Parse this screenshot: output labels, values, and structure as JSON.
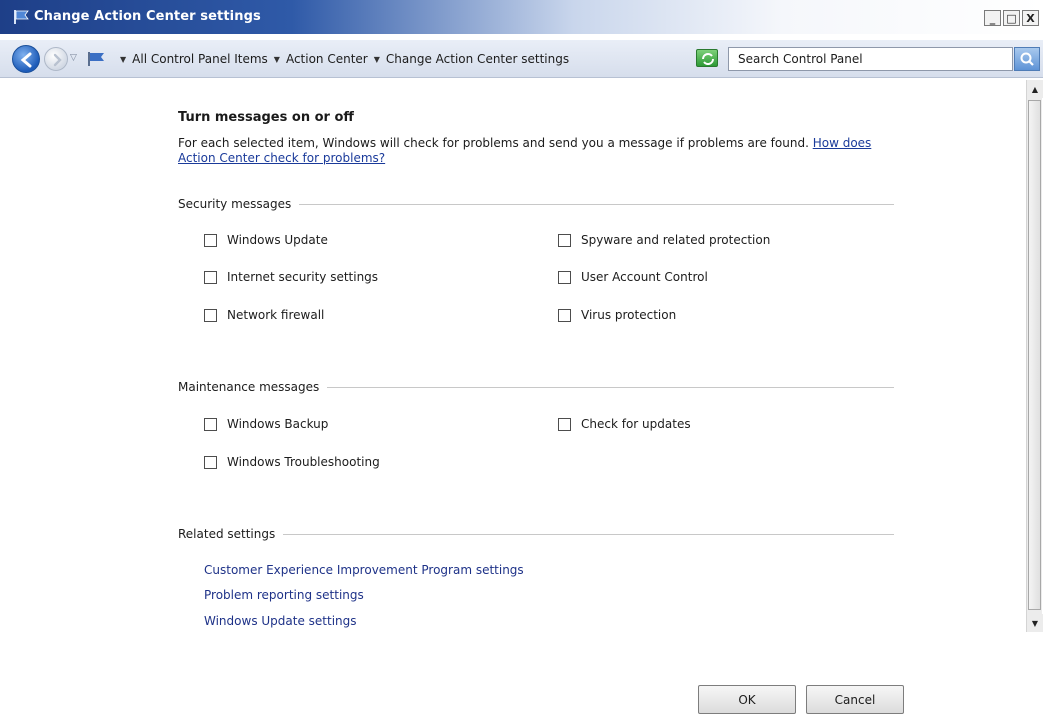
{
  "window": {
    "title": "Change Action Center settings",
    "minimize_label": "_",
    "maximize_label": "□",
    "close_label": "X"
  },
  "address": {
    "breadcrumbs": [
      "All Control Panel Items",
      "Action Center",
      "Change Action Center settings"
    ],
    "search_placeholder": "Search Control Panel"
  },
  "content": {
    "heading": "Turn messages on or off",
    "description": "For each selected item, Windows will check for problems and send you a message if problems are found.",
    "help_link": "How does Action Center check for problems?"
  },
  "security": {
    "title": "Security messages",
    "items": [
      {
        "label": "Windows Update",
        "checked": false
      },
      {
        "label": "Spyware and related protection",
        "checked": false
      },
      {
        "label": "Internet security settings",
        "checked": false
      },
      {
        "label": "User Account Control",
        "checked": false
      },
      {
        "label": "Network firewall",
        "checked": false
      },
      {
        "label": "Virus protection",
        "checked": false
      }
    ]
  },
  "maintenance": {
    "title": "Maintenance messages",
    "items": [
      {
        "label": "Windows Backup",
        "checked": false
      },
      {
        "label": "Check for updates",
        "checked": false
      },
      {
        "label": "Windows Troubleshooting",
        "checked": false
      }
    ]
  },
  "related": {
    "title": "Related settings",
    "links": [
      "Customer Experience Improvement Program settings",
      "Problem reporting settings",
      "Windows Update settings"
    ]
  },
  "buttons": {
    "ok": "OK",
    "cancel": "Cancel"
  }
}
